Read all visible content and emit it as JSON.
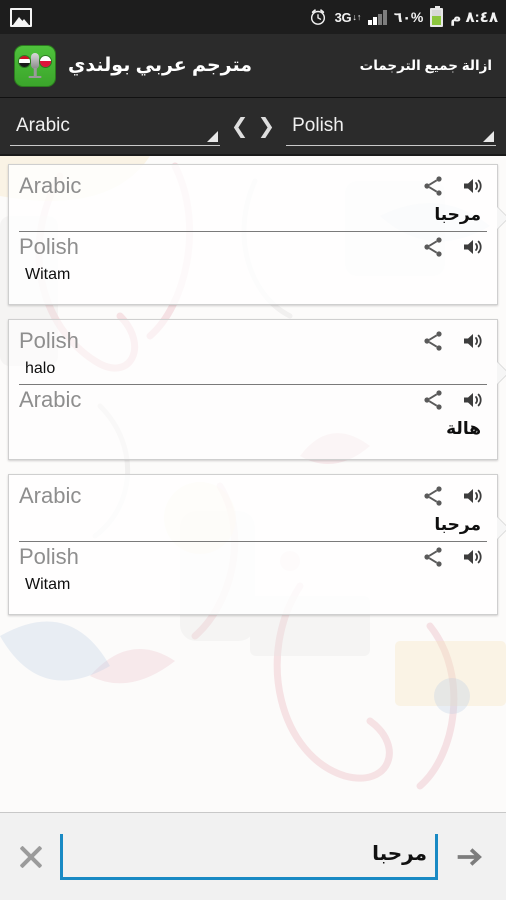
{
  "status_bar": {
    "gallery_icon": "image-icon",
    "alarm_icon": "alarm-clock-icon",
    "network_label": "3G",
    "data_arrows": "↓↑",
    "signal_icon": "signal-bars-icon",
    "battery_percent": "٦٠%",
    "battery_icon": "battery-icon",
    "clock": "٨:٤٨ م"
  },
  "action_bar": {
    "app_icon": "app-logo-icon",
    "title": "مترجم عربي بولندي",
    "clear_all_label": "ازالة جميع الترجمات"
  },
  "lang_bar": {
    "source": "Arabic",
    "target": "Polish",
    "swap_left": "❮",
    "swap_right": "❯"
  },
  "cards": [
    {
      "top": {
        "lang": "Arabic",
        "text": "مرحبا",
        "rtl": true
      },
      "bottom": {
        "lang": "Polish",
        "text": "Witam",
        "rtl": false
      }
    },
    {
      "top": {
        "lang": "Polish",
        "text": "halo",
        "rtl": false
      },
      "bottom": {
        "lang": "Arabic",
        "text": "هالة",
        "rtl": true
      }
    },
    {
      "top": {
        "lang": "Arabic",
        "text": "مرحبا",
        "rtl": true
      },
      "bottom": {
        "lang": "Polish",
        "text": "Witam",
        "rtl": false
      }
    }
  ],
  "row_icons": {
    "share": "share-icon",
    "speaker": "speaker-icon"
  },
  "input_bar": {
    "clear_icon": "close-icon",
    "value": "مرحبا",
    "placeholder": "",
    "send_icon": "arrow-right-icon"
  },
  "colors": {
    "status_bar_bg": "#1d1d1d",
    "action_bar_bg": "#2b2b2b",
    "accent_blue": "#1a8ac4",
    "app_icon_green": "#4fc23c",
    "battery_green": "#8cc63e",
    "label_gray": "#8e8e8e"
  }
}
